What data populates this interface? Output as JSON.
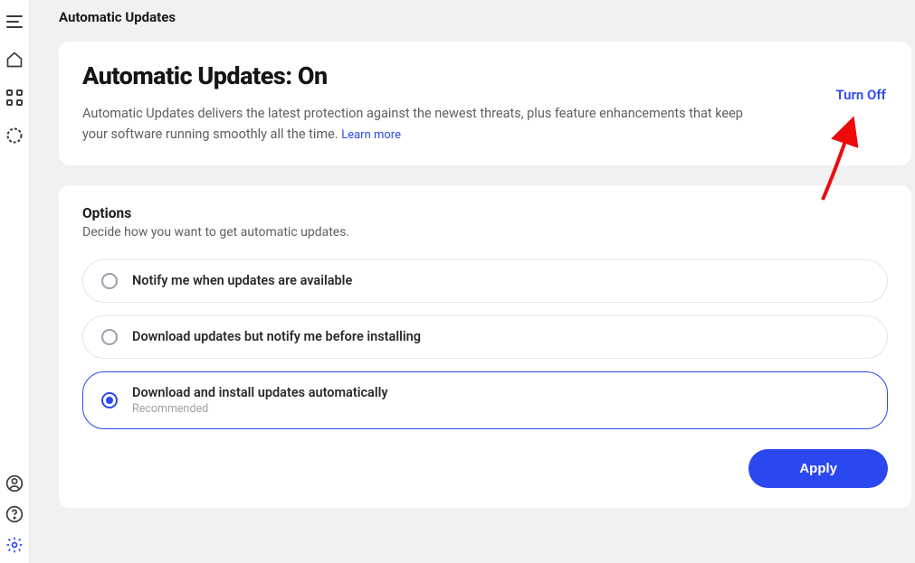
{
  "page": {
    "title": "Automatic Updates"
  },
  "hero": {
    "title": "Automatic Updates: On",
    "description": "Automatic Updates delivers the latest protection against the newest threats, plus feature enhancements that keep your software running smoothly all the time. ",
    "learn_more": "Learn more",
    "turn_off": "Turn Off"
  },
  "options": {
    "title": "Options",
    "subtitle": "Decide how you want to get automatic updates.",
    "items": [
      {
        "label": "Notify me when updates are available",
        "sub": "",
        "selected": false
      },
      {
        "label": "Download updates but notify me before installing",
        "sub": "",
        "selected": false
      },
      {
        "label": "Download and install updates automatically",
        "sub": "Recommended",
        "selected": true
      }
    ]
  },
  "actions": {
    "apply": "Apply"
  },
  "colors": {
    "accent": "#2b47f0",
    "arrow": "#ee0a0a"
  }
}
